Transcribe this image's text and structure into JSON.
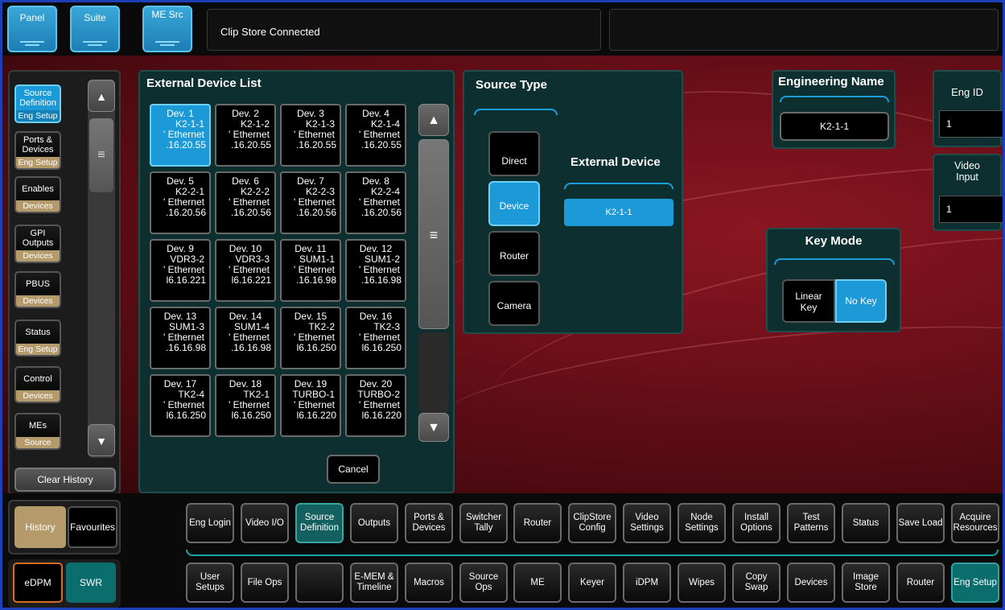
{
  "top": {
    "buttons": [
      "Panel",
      "Suite",
      "ME Src"
    ],
    "status": "Clip Store Connected",
    "status2": ""
  },
  "history": {
    "items": [
      {
        "label": "Source Definition",
        "sub": "Eng Setup",
        "selected": true
      },
      {
        "label": "Ports & Devices",
        "sub": "Eng Setup"
      },
      {
        "label": "Enables",
        "sub": "Devices"
      },
      {
        "label": "GPI Outputs",
        "sub": "Devices"
      },
      {
        "label": "PBUS",
        "sub": "Devices"
      },
      {
        "label": "Status",
        "sub": "Eng Setup"
      },
      {
        "label": "Control",
        "sub": "Devices"
      },
      {
        "label": "MEs",
        "sub": "Source Ops"
      }
    ],
    "clear_label": "Clear History",
    "tab_history": "History",
    "tab_favourites": "Favourites"
  },
  "device_list": {
    "title": "External Device List",
    "cancel_label": "Cancel",
    "devices": [
      {
        "dev": "Dev. 1",
        "name": "K2-1-1",
        "conn": "' Ethernet",
        "addr": ".16.20.55",
        "selected": true
      },
      {
        "dev": "Dev. 2",
        "name": "K2-1-2",
        "conn": "' Ethernet",
        "addr": ".16.20.55"
      },
      {
        "dev": "Dev. 3",
        "name": "K2-1-3",
        "conn": "' Ethernet",
        "addr": ".16.20.55"
      },
      {
        "dev": "Dev. 4",
        "name": "K2-1-4",
        "conn": "' Ethernet",
        "addr": ".16.20.55"
      },
      {
        "dev": "Dev. 5",
        "name": "K2-2-1",
        "conn": "' Ethernet",
        "addr": ".16.20.56"
      },
      {
        "dev": "Dev. 6",
        "name": "K2-2-2",
        "conn": "' Ethernet",
        "addr": ".16.20.56"
      },
      {
        "dev": "Dev. 7",
        "name": "K2-2-3",
        "conn": "' Ethernet",
        "addr": ".16.20.56"
      },
      {
        "dev": "Dev. 8",
        "name": "K2-2-4",
        "conn": "' Ethernet",
        "addr": ".16.20.56"
      },
      {
        "dev": "Dev. 9",
        "name": "VDR3-2",
        "conn": "' Ethernet",
        "addr": "l6.16.221"
      },
      {
        "dev": "Dev. 10",
        "name": "VDR3-3",
        "conn": "' Ethernet",
        "addr": "l6.16.221"
      },
      {
        "dev": "Dev. 11",
        "name": "SUM1-1",
        "conn": "' Ethernet",
        "addr": ".16.16.98"
      },
      {
        "dev": "Dev. 12",
        "name": "SUM1-2",
        "conn": "' Ethernet",
        "addr": ".16.16.98"
      },
      {
        "dev": "Dev. 13",
        "name": "SUM1-3",
        "conn": "' Ethernet",
        "addr": ".16.16.98"
      },
      {
        "dev": "Dev. 14",
        "name": "SUM1-4",
        "conn": "' Ethernet",
        "addr": ".16.16.98"
      },
      {
        "dev": "Dev. 15",
        "name": "TK2-2",
        "conn": "' Ethernet",
        "addr": "l6.16.250"
      },
      {
        "dev": "Dev. 16",
        "name": "TK2-3",
        "conn": "' Ethernet",
        "addr": "l6.16.250"
      },
      {
        "dev": "Dev. 17",
        "name": "TK2-4",
        "conn": "' Ethernet",
        "addr": "l6.16.250"
      },
      {
        "dev": "Dev. 18",
        "name": "TK2-1",
        "conn": "' Ethernet",
        "addr": "l6.16.250"
      },
      {
        "dev": "Dev. 19",
        "name": "TURBO-1",
        "conn": "' Ethernet",
        "addr": "l6.16.220"
      },
      {
        "dev": "Dev. 20",
        "name": "TURBO-2",
        "conn": "' Ethernet",
        "addr": "l6.16.220"
      }
    ]
  },
  "source_type": {
    "title": "Source Type",
    "options": [
      "Direct",
      "Device",
      "Router",
      "Camera"
    ],
    "selected": "Device",
    "external_device_title": "External Device",
    "external_device_value": "K2-1-1"
  },
  "engineering_name": {
    "title": "Engineering Name",
    "value": "K2-1-1"
  },
  "eng_id": {
    "title": "Eng ID",
    "value": "1"
  },
  "video_input": {
    "title": "Video Input",
    "value": "1"
  },
  "key_mode": {
    "title": "Key Mode",
    "options": [
      "Linear Key",
      "No Key"
    ],
    "selected": "No Key"
  },
  "tabs_row1": [
    "Eng Login",
    "Video I/O",
    "Source Definition",
    "Outputs",
    "Ports & Devices",
    "Switcher Tally",
    "Router",
    "ClipStore Config",
    "Video Settings",
    "Node Settings",
    "Install Options",
    "Test Patterns",
    "Status",
    "Save Load",
    "Acquire Resources"
  ],
  "tabs_row1_active": "Source Definition",
  "tabs_row2": [
    "User Setups",
    "File Ops",
    "",
    "E-MEM & Timeline",
    "Macros",
    "Source Ops",
    "ME",
    "Keyer",
    "iDPM",
    "Wipes",
    "Copy Swap",
    "Devices",
    "Image Store",
    "Router",
    "Eng Setup"
  ],
  "tabs_row2_active": "Eng Setup",
  "mode": {
    "edpm": "eDPM",
    "swr": "SWR"
  },
  "colors": {
    "accent": "#1c9ad8",
    "panel": "#0e2f2f",
    "teal": "#0c6d6d",
    "history_sub": "#b59b6b"
  }
}
